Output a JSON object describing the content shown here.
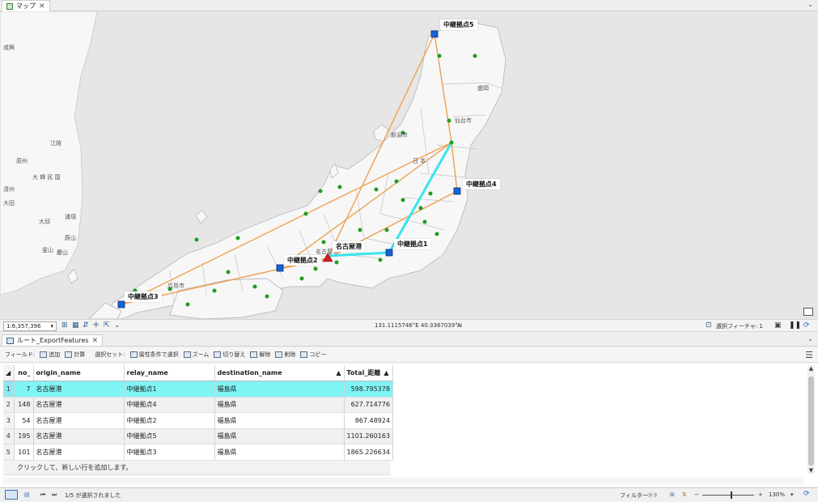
{
  "map_tab": {
    "label": "マップ"
  },
  "map": {
    "labels": {
      "relay5": "中継拠点5",
      "relay4": "中継拠点4",
      "relay1": "中継拠点1",
      "relay2": "中継拠点2",
      "relay3": "中継拠点3",
      "nagoya": "名古屋港"
    },
    "places": [
      "咸興",
      "江陵",
      "原州",
      "大 韓 民 国",
      "清州",
      "大邱",
      "浦項",
      "蔚山",
      "釜山",
      "慶山",
      "大田",
      "新潟市",
      "仙台市",
      "日 本",
      "広島市",
      "名古屋市",
      "盛岡"
    ],
    "colors": {
      "route_orange": "#f0a050",
      "route_selected": "#38e4ee",
      "relay_blue": "#1464d8",
      "pref_green": "#1f9d1f"
    }
  },
  "map_status": {
    "scale": "1:6,357,396",
    "coordinates": "131.1115746°E 40.3367039°N",
    "selected_features": "選択フィーチャ: 1"
  },
  "table_tab": {
    "label": "ルート_ExportFeatures"
  },
  "toolbar": {
    "field_label": "フィールド:",
    "add": "追加",
    "calculate": "計算",
    "selection_label": "選択セット:",
    "select_by_attr": "属性条件で選択",
    "zoom": "ズーム",
    "switch": "切り替え",
    "clear": "解除",
    "delete": "削除",
    "copy": "コピー"
  },
  "table": {
    "columns": [
      "no_",
      "origin_name",
      "relay_name",
      "destination_name",
      "Total_距離"
    ],
    "rows": [
      {
        "row": "1",
        "no": "7",
        "origin": "名古屋港",
        "relay": "中継拠点1",
        "dest": "福島県",
        "total": "598.795378"
      },
      {
        "row": "2",
        "no": "148",
        "origin": "名古屋港",
        "relay": "中継拠点4",
        "dest": "福島県",
        "total": "627.714776"
      },
      {
        "row": "3",
        "no": "54",
        "origin": "名古屋港",
        "relay": "中継拠点2",
        "dest": "福島県",
        "total": "867.48924"
      },
      {
        "row": "4",
        "no": "195",
        "origin": "名古屋港",
        "relay": "中継拠点5",
        "dest": "福島県",
        "total": "1101.260163"
      },
      {
        "row": "5",
        "no": "101",
        "origin": "名古屋港",
        "relay": "中継拠点3",
        "dest": "福島県",
        "total": "1865.226634"
      }
    ],
    "add_row_hint": "クリックして、新しい行を追加します。"
  },
  "bottom_status": {
    "selection_count": "1/5 が選択されました",
    "filter_label": "フィルター:",
    "zoom_level": "130%",
    "zoom_fraction": 0.55
  }
}
